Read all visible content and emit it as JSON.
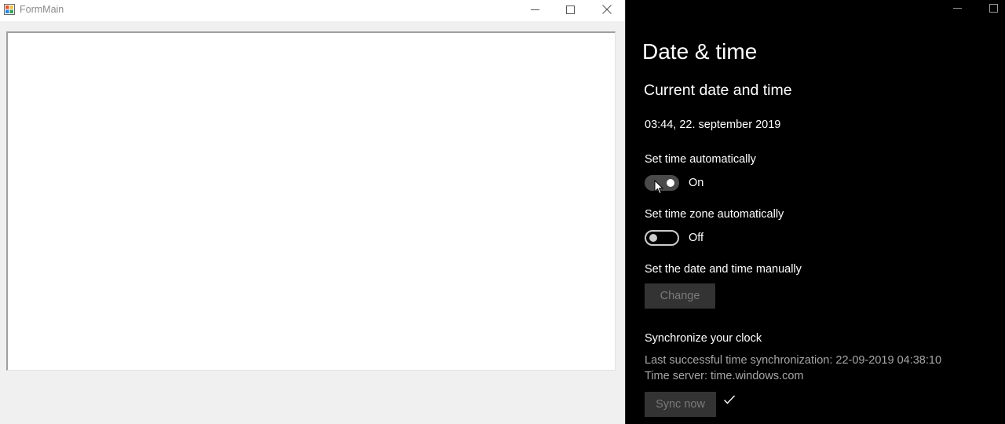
{
  "form_window": {
    "title": "FormMain",
    "controls": [
      "minimize-icon",
      "maximize-icon",
      "close-icon"
    ]
  },
  "settings": {
    "page_title": "Date & time",
    "section_title": "Current date and time",
    "current_datetime": "03:44, 22. september 2019",
    "set_time_auto": {
      "label": "Set time automatically",
      "state": "On"
    },
    "set_timezone_auto": {
      "label": "Set time zone automatically",
      "state": "Off"
    },
    "manual": {
      "label": "Set the date and time manually",
      "button": "Change"
    },
    "sync": {
      "heading": "Synchronize your clock",
      "last_sync": "Last successful time synchronization: 22-09-2019 04:38:10",
      "time_server": "Time server: time.windows.com",
      "button": "Sync now"
    }
  },
  "colors": {
    "settings_bg": "#000000",
    "form_bg": "#f0f0f0",
    "disabled_button_bg": "#333333",
    "secondary_text": "#a6a6a6"
  }
}
